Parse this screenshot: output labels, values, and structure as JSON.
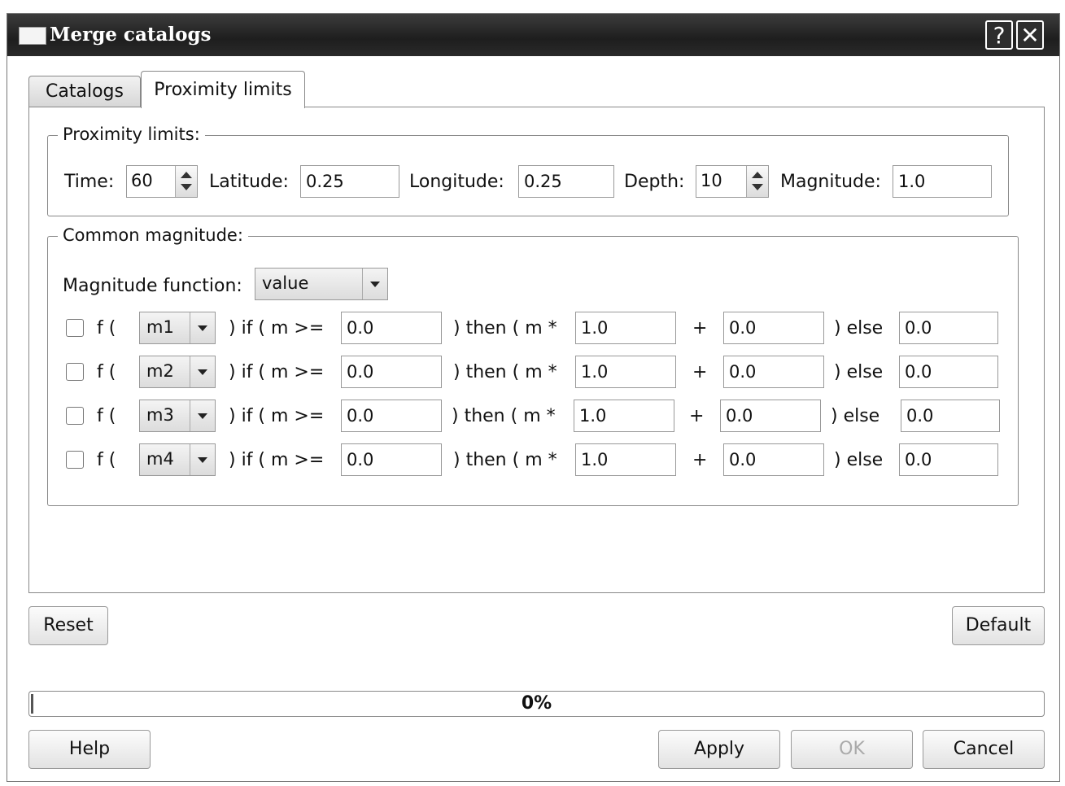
{
  "window": {
    "title": "Merge catalogs",
    "help_glyph": "?",
    "close_glyph": "✕"
  },
  "tabs": [
    {
      "label": "Catalogs",
      "active": false
    },
    {
      "label": "Proximity limits",
      "active": true
    }
  ],
  "proximity": {
    "legend": "Proximity limits:",
    "time_label": "Time:",
    "time_value": "60",
    "latitude_label": "Latitude:",
    "latitude_value": "0.25",
    "longitude_label": "Longitude:",
    "longitude_value": "0.25",
    "depth_label": "Depth:",
    "depth_value": "10",
    "magnitude_label": "Magnitude:",
    "magnitude_value": "1.0"
  },
  "common": {
    "legend": "Common magnitude:",
    "function_label": "Magnitude function:",
    "function_value": "value",
    "rows": [
      {
        "f": "f (",
        "var": "m1",
        "if": ") if ( m  >=",
        "threshold": "0.0",
        "then": ") then ( m *",
        "mult": "1.0",
        "plus": "+",
        "add": "0.0",
        "else": ") else",
        "else_value": "0.0"
      },
      {
        "f": "f (",
        "var": "m2",
        "if": ") if ( m  >=",
        "threshold": "0.0",
        "then": ") then ( m *",
        "mult": "1.0",
        "plus": "+",
        "add": "0.0",
        "else": ") else",
        "else_value": "0.0"
      },
      {
        "f": "f (",
        "var": "m3",
        "if": ") if ( m  >=",
        "threshold": "0.0",
        "then": ") then ( m *",
        "mult": "1.0",
        "plus": "+",
        "add": "0.0",
        "else": ") else",
        "else_value": "0.0"
      },
      {
        "f": "f (",
        "var": "m4",
        "if": ") if ( m  >=",
        "threshold": "0.0",
        "then": ") then ( m *",
        "mult": "1.0",
        "plus": "+",
        "add": "0.0",
        "else": ") else",
        "else_value": "0.0"
      }
    ]
  },
  "buttons": {
    "reset": "Reset",
    "default": "Default",
    "help": "Help",
    "apply": "Apply",
    "ok": "OK",
    "cancel": "Cancel"
  },
  "progress": {
    "percent": 0,
    "label": "0%"
  }
}
